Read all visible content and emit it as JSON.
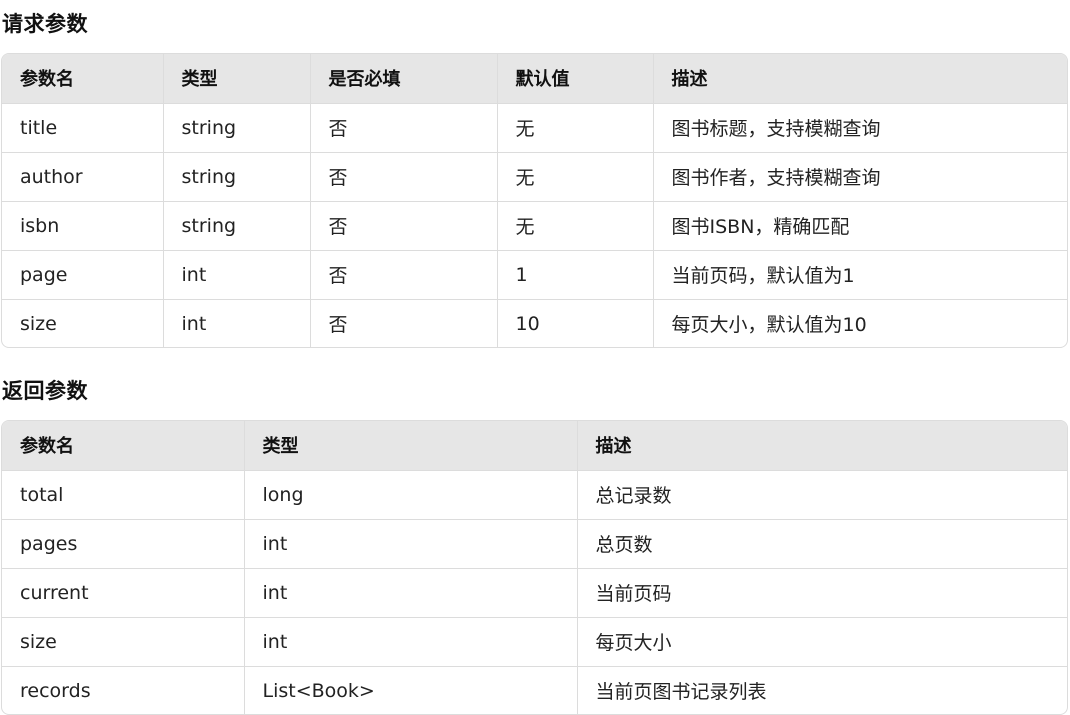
{
  "request": {
    "title": "请求参数",
    "headers": [
      "参数名",
      "类型",
      "是否必填",
      "默认值",
      "描述"
    ],
    "rows": [
      [
        "title",
        "string",
        "否",
        "无",
        "图书标题，支持模糊查询"
      ],
      [
        "author",
        "string",
        "否",
        "无",
        "图书作者，支持模糊查询"
      ],
      [
        "isbn",
        "string",
        "否",
        "无",
        "图书ISBN，精确匹配"
      ],
      [
        "page",
        "int",
        "否",
        "1",
        "当前页码，默认值为1"
      ],
      [
        "size",
        "int",
        "否",
        "10",
        "每页大小，默认值为10"
      ]
    ]
  },
  "response": {
    "title": "返回参数",
    "headers": [
      "参数名",
      "类型",
      "描述"
    ],
    "rows": [
      [
        "total",
        "long",
        "总记录数"
      ],
      [
        "pages",
        "int",
        "总页数"
      ],
      [
        "current",
        "int",
        "当前页码"
      ],
      [
        "size",
        "int",
        "每页大小"
      ],
      [
        "records",
        "List<Book>",
        "当前页图书记录列表"
      ]
    ]
  }
}
